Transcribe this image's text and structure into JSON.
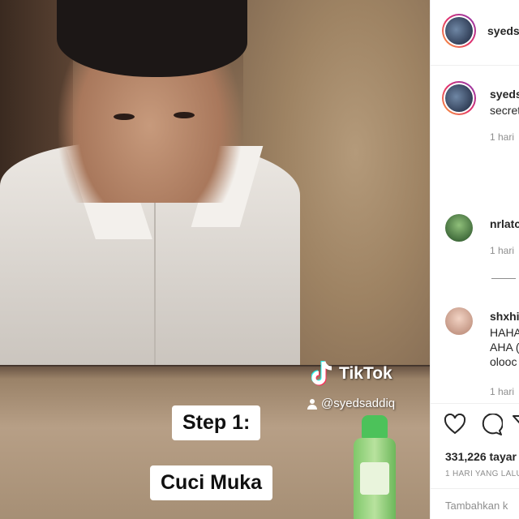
{
  "video": {
    "watermark_brand": "TikTok",
    "watermark_handle": "@syedsaddiq",
    "captions": [
      "Step 1:",
      "Cuci Muka"
    ]
  },
  "sidebar": {
    "header_username": "syeds",
    "post_caption": {
      "username": "syeds",
      "text": "secret",
      "time": "1 hari"
    },
    "comments": [
      {
        "username": "nrlatc",
        "lines": [],
        "time": "1 hari"
      },
      {
        "username": "shxhi",
        "lines": [
          "HAHA",
          "AHA (",
          "olooc"
        ],
        "time": "1 hari"
      }
    ],
    "likes": "331,226 tayar",
    "date": "1 HARI YANG LALU",
    "add_comment_placeholder": "Tambahkan k"
  },
  "colors": {
    "accent_ring_start": "#f9a13b",
    "accent_ring_mid": "#e1306c",
    "accent_ring_end": "#833ab4",
    "text_primary": "#262626",
    "text_secondary": "#8e8e8e"
  },
  "icons": [
    "tiktok-logo-icon",
    "person-icon",
    "heart-icon",
    "comment-icon",
    "share-icon"
  ]
}
